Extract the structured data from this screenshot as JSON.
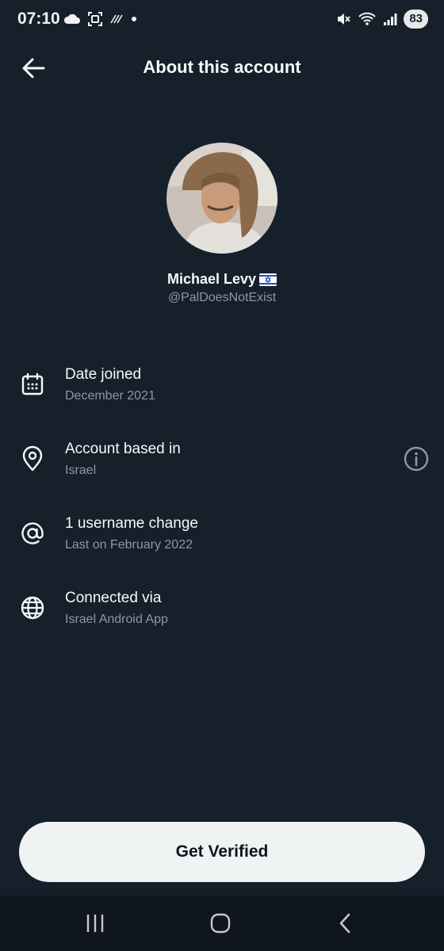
{
  "status_bar": {
    "time": "07:10",
    "battery": "83",
    "left_icons": [
      "cloud-icon",
      "screenshot-icon",
      "sync-icon",
      "dot-icon"
    ],
    "right_icons": [
      "mute-icon",
      "wifi-icon",
      "signal-icon"
    ]
  },
  "header": {
    "title": "About this account",
    "back_icon": "arrow-left-icon"
  },
  "profile": {
    "name": "Michael Levy",
    "flag_emoji": "🇮🇱",
    "handle": "@PalDoesNotExist"
  },
  "details": [
    {
      "icon": "calendar-icon",
      "label": "Date joined",
      "value": "December 2021"
    },
    {
      "icon": "location-pin-icon",
      "label": "Account based in",
      "value": "Israel",
      "info_icon": "info-icon"
    },
    {
      "icon": "at-sign-icon",
      "label": "1 username change",
      "value": "Last on February 2022"
    },
    {
      "icon": "globe-icon",
      "label": "Connected via",
      "value": "Israel Android App"
    }
  ],
  "cta": {
    "label": "Get Verified"
  },
  "nav_bar": {
    "icons": [
      "recent-apps-icon",
      "home-icon",
      "back-icon"
    ]
  },
  "colors": {
    "background": "#15202b",
    "text_primary": "#e7e9ea",
    "text_secondary": "#8b98a5",
    "button_bg": "#eff3f4"
  }
}
